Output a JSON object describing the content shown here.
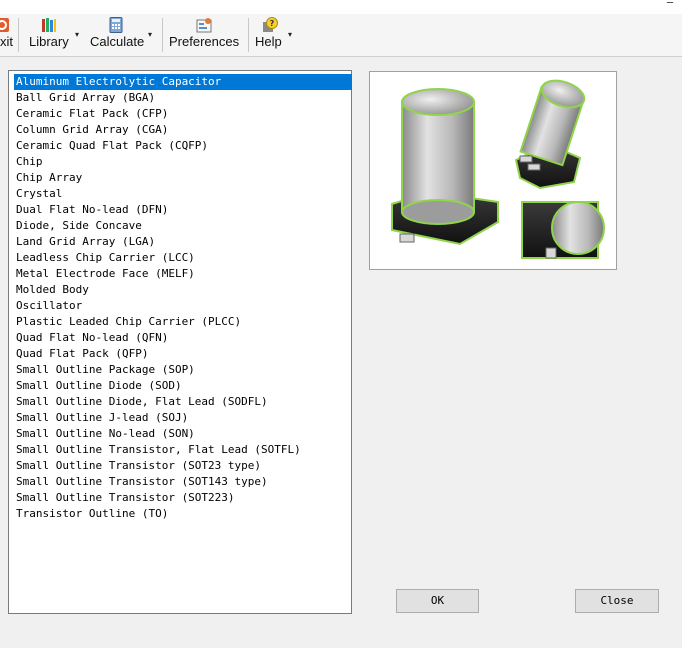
{
  "toolbar": {
    "exit_label": "xit",
    "library_label": "Library",
    "calculate_label": "Calculate",
    "preferences_label": "Preferences",
    "help_label": "Help",
    "dropdown_glyph": "▾"
  },
  "package_list": {
    "selected_index": 0,
    "items": [
      "Aluminum Electrolytic Capacitor",
      "Ball Grid Array (BGA)",
      "Ceramic Flat Pack (CFP)",
      "Column Grid Array (CGA)",
      "Ceramic Quad Flat Pack (CQFP)",
      "Chip",
      "Chip Array",
      "Crystal",
      "Dual Flat No-lead (DFN)",
      "Diode, Side Concave",
      "Land Grid Array (LGA)",
      "Leadless Chip Carrier (LCC)",
      "Metal Electrode Face (MELF)",
      "Molded Body",
      "Oscillator",
      "Plastic Leaded Chip Carrier (PLCC)",
      "Quad Flat No-lead (QFN)",
      "Quad Flat Pack (QFP)",
      "Small Outline Package (SOP)",
      "Small Outline Diode (SOD)",
      "Small Outline Diode, Flat Lead (SODFL)",
      "Small Outline J-lead (SOJ)",
      "Small Outline No-lead (SON)",
      "Small Outline Transistor, Flat Lead (SOTFL)",
      "Small Outline Transistor (SOT23 type)",
      "Small Outline Transistor (SOT143 type)",
      "Small Outline Transistor (SOT223)",
      "Transistor Outline (TO)"
    ]
  },
  "buttons": {
    "ok": "OK",
    "close": "Close"
  },
  "colors": {
    "selection": "#0078d7",
    "glow": "#8fd44a"
  }
}
